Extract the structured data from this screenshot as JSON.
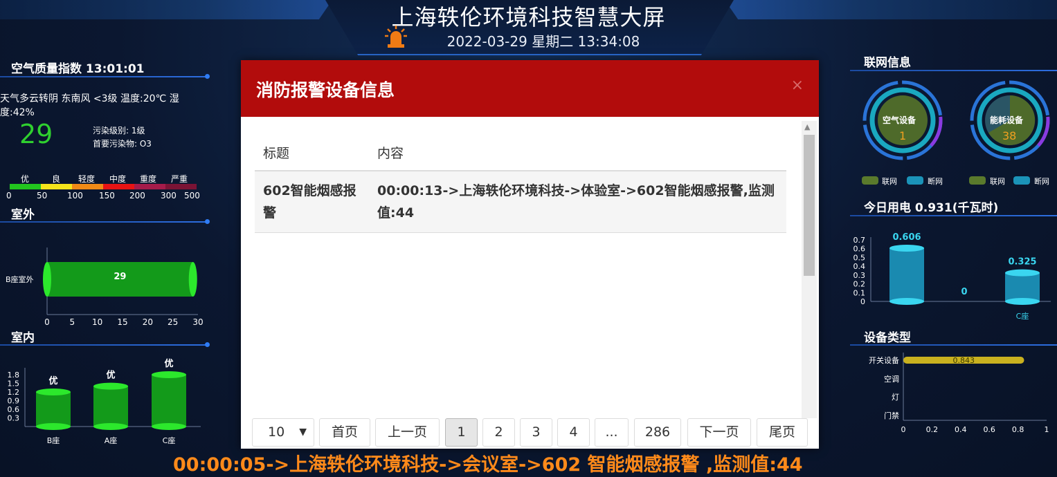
{
  "header": {
    "title": "上海轶伦环境科技智慧大屏",
    "datetime": "2022-03-29 星期二 13:34:08"
  },
  "air_quality": {
    "title": "空气质量指数 13:01:01",
    "weather_line1": "天气多云转阴 东南风 <3级 温度:20℃ 湿",
    "weather_line2": "度:42%",
    "aqi_value": "29",
    "pollution_level": "污染级别:  1级",
    "primary_pollutant": "首要污染物: O3",
    "scale_labels": [
      "优",
      "良",
      "轻度",
      "中度",
      "重度",
      "严重"
    ],
    "scale_numbers": [
      "0",
      "50",
      "100",
      "150",
      "200",
      "300",
      "500"
    ],
    "scale_colors": [
      "#22c51e",
      "#f5e51b",
      "#f08a16",
      "#e81313",
      "#a51b4a",
      "#7b1335"
    ]
  },
  "outdoor": {
    "title": "室外",
    "chart_data": {
      "type": "bar",
      "categories": [
        "B座室外"
      ],
      "values": [
        29
      ],
      "xlim": [
        0,
        30
      ],
      "xticks": [
        "0",
        "5",
        "10",
        "15",
        "20",
        "25",
        "30"
      ],
      "orientation": "horizontal"
    }
  },
  "indoor": {
    "title": "室内",
    "chart_data": {
      "type": "bar",
      "categories": [
        "B座",
        "A座",
        "C座"
      ],
      "values": [
        1.2,
        1.4,
        1.8
      ],
      "data_labels": [
        "优",
        "优",
        "优"
      ],
      "yticks": [
        "1.8",
        "1.5",
        "1.2",
        "0.9",
        "0.6",
        "0.3"
      ],
      "ylim": [
        0,
        1.8
      ]
    }
  },
  "network": {
    "title": "联网信息",
    "air_device_label": "空气设备",
    "air_device_value": "1",
    "energy_device_label": "能耗设备",
    "energy_device_value": "38",
    "legend_online": "联网",
    "legend_offline": "断网"
  },
  "power": {
    "title": "今日用电 0.931(千瓦时)",
    "chart_data": {
      "type": "bar",
      "categories": [
        "",
        "",
        "C座"
      ],
      "values": [
        0.606,
        0,
        0.325
      ],
      "data_labels": [
        "0.606",
        "0",
        "0.325"
      ],
      "yticks": [
        "0.7",
        "0.6",
        "0.5",
        "0.4",
        "0.3",
        "0.2",
        "0.1",
        "0"
      ],
      "ylim": [
        0,
        0.7
      ]
    }
  },
  "device_types": {
    "title": "设备类型",
    "chart_data": {
      "type": "bar",
      "orientation": "horizontal",
      "categories": [
        "开关设备",
        "空调",
        "灯",
        "门禁"
      ],
      "values": [
        0.843,
        0,
        0,
        0
      ],
      "data_labels": [
        "0.843"
      ],
      "xticks": [
        "0",
        "0.2",
        "0.4",
        "0.6",
        "0.8",
        "1"
      ],
      "xlim": [
        0,
        1
      ]
    }
  },
  "modal": {
    "title": "消防报警设备信息",
    "close": "×",
    "col_title": "标题",
    "col_content": "内容",
    "row_title": "602智能烟感报警",
    "row_content": "00:00:13->上海轶伦环境科技->体验室->602智能烟感报警,监测值:44",
    "page_size": "10",
    "btn_first": "首页",
    "btn_prev": "上一页",
    "pages": [
      "1",
      "2",
      "3",
      "4",
      "...",
      "286"
    ],
    "btn_next": "下一页",
    "btn_last": "尾页"
  },
  "ticker": "00:00:05->上海轶伦环境科技->会议室->602 智能烟感报警 ,监测值:44"
}
